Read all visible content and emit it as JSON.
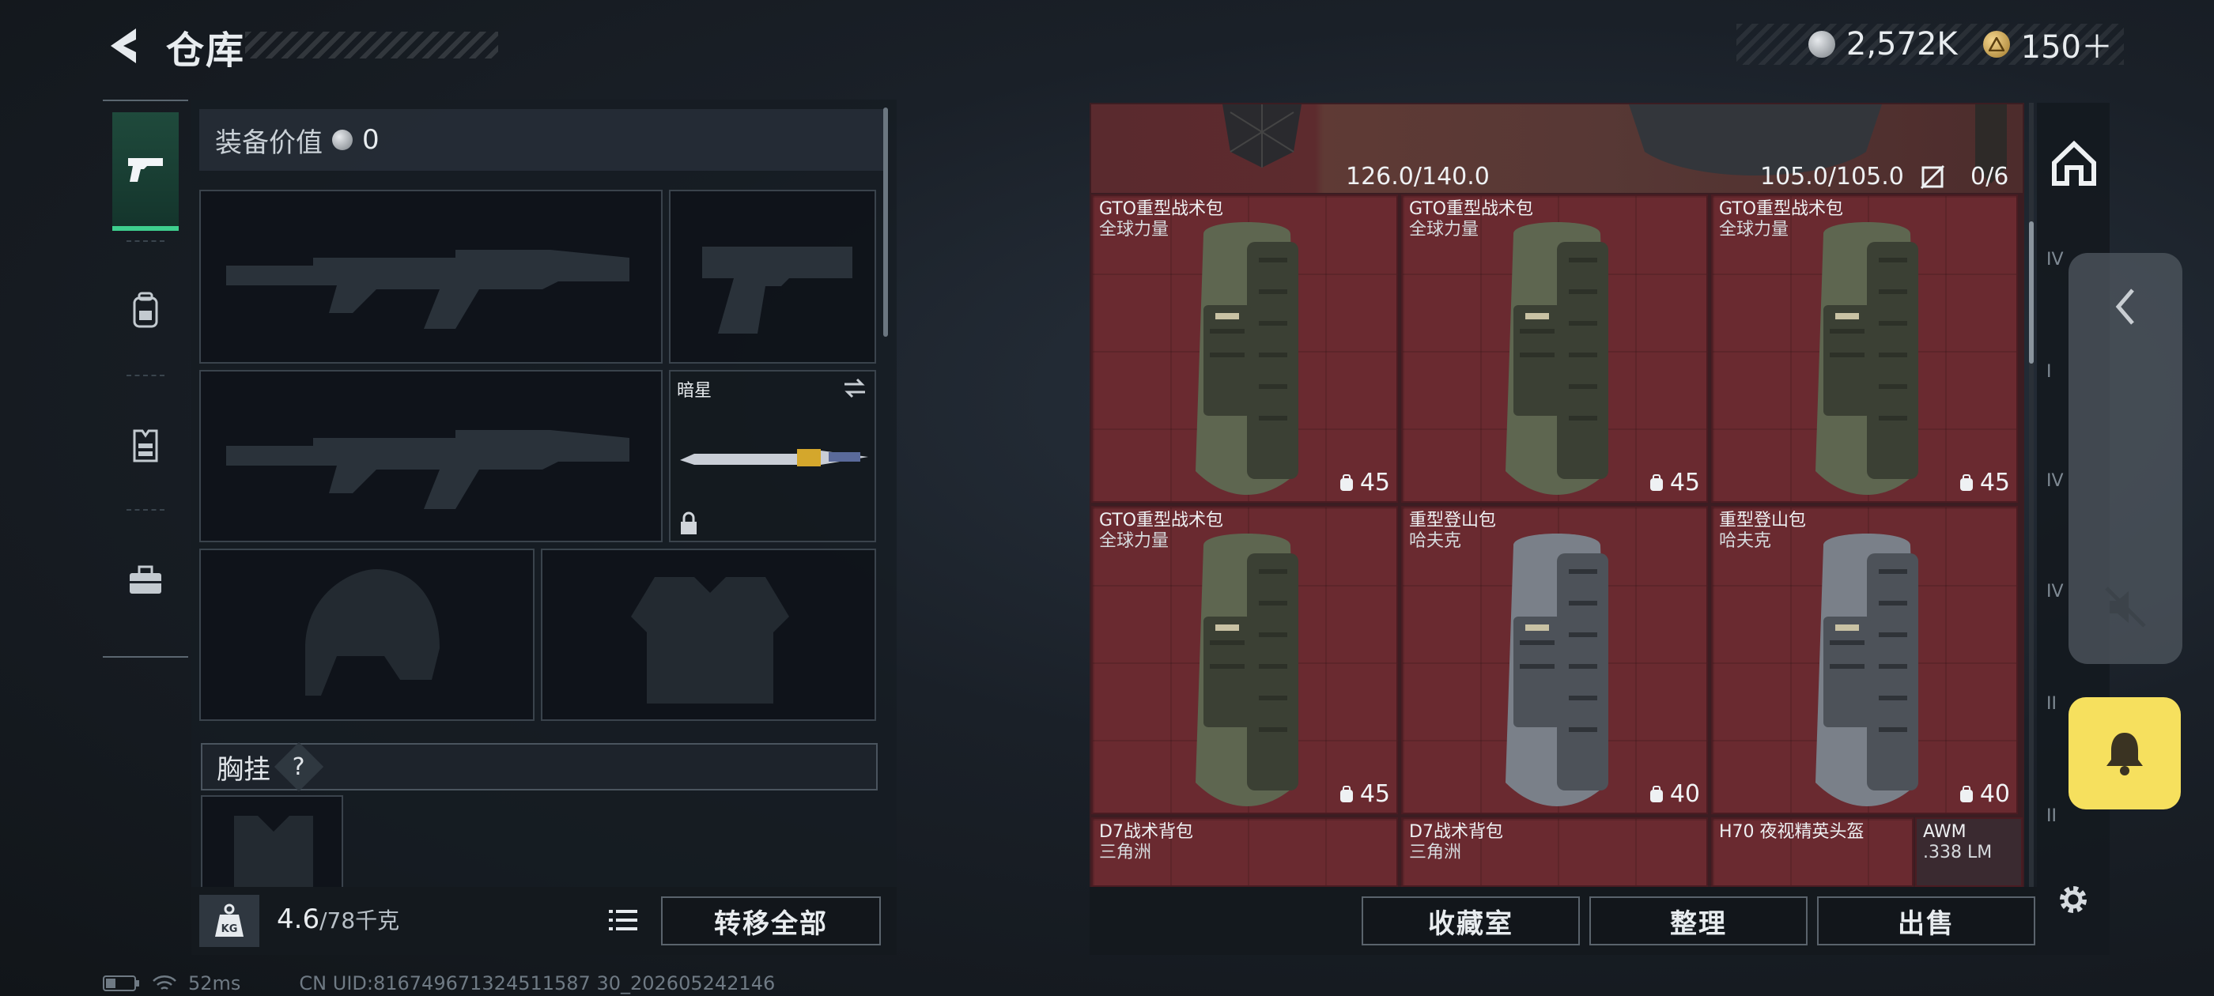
{
  "header": {
    "title": "仓库",
    "currency": [
      {
        "icon": "silver-coin-icon",
        "value": "2,572K"
      },
      {
        "icon": "gold-coin-icon",
        "value": "150＋"
      }
    ]
  },
  "left_rail": {
    "items": [
      {
        "icon": "pistol-icon",
        "active": true
      },
      {
        "icon": "backpack-icon",
        "active": false
      },
      {
        "icon": "vest-icon",
        "active": false
      },
      {
        "icon": "toolbox-icon",
        "active": false
      }
    ]
  },
  "equipment": {
    "value_label": "装备价值",
    "value": "0",
    "melee_name": "暗星",
    "chest_label": "胸挂",
    "chest_help": "?"
  },
  "weight": {
    "icon": "kg-weight-icon",
    "current": "4.6",
    "max": "/78千克",
    "transfer_all": "转移全部"
  },
  "status": {
    "ping": "52ms",
    "uid": "CN UID:816749671324511587 30_202605242146"
  },
  "stash": {
    "top_capacity_left": "126.0/140.0",
    "top_capacity_right": "105.0/105.0",
    "slot_count": "0/6",
    "items": [
      {
        "name": "GTO重型战术包",
        "sub": "全球力量",
        "durability": "45",
        "color": "olive"
      },
      {
        "name": "GTO重型战术包",
        "sub": "全球力量",
        "durability": "45",
        "color": "olive"
      },
      {
        "name": "GTO重型战术包",
        "sub": "全球力量",
        "durability": "45",
        "color": "olive"
      },
      {
        "name": "GTO重型战术包",
        "sub": "全球力量",
        "durability": "45",
        "color": "olive"
      },
      {
        "name": "重型登山包",
        "sub": "哈夫克",
        "durability": "40",
        "color": "gray"
      },
      {
        "name": "重型登山包",
        "sub": "哈夫克",
        "durability": "40",
        "color": "gray"
      }
    ],
    "partial_items": [
      {
        "name": "D7战术背包",
        "sub": "三角洲"
      },
      {
        "name": "D7战术背包",
        "sub": "三角洲"
      },
      {
        "name": "H70 夜视精英头盔",
        "sub": ""
      },
      {
        "name": "AWM",
        "sub": ".338 LM"
      }
    ],
    "buttons": {
      "collection": "收藏室",
      "organize": "整理",
      "sell": "出售"
    }
  },
  "right_rail": {
    "tiers": [
      "IV",
      "I",
      "IV",
      "IV",
      "II",
      "II"
    ]
  },
  "colors": {
    "accent_green": "#3ecf8e",
    "stash_red": "#6a2a30",
    "bell_yellow": "#f6e05e"
  }
}
